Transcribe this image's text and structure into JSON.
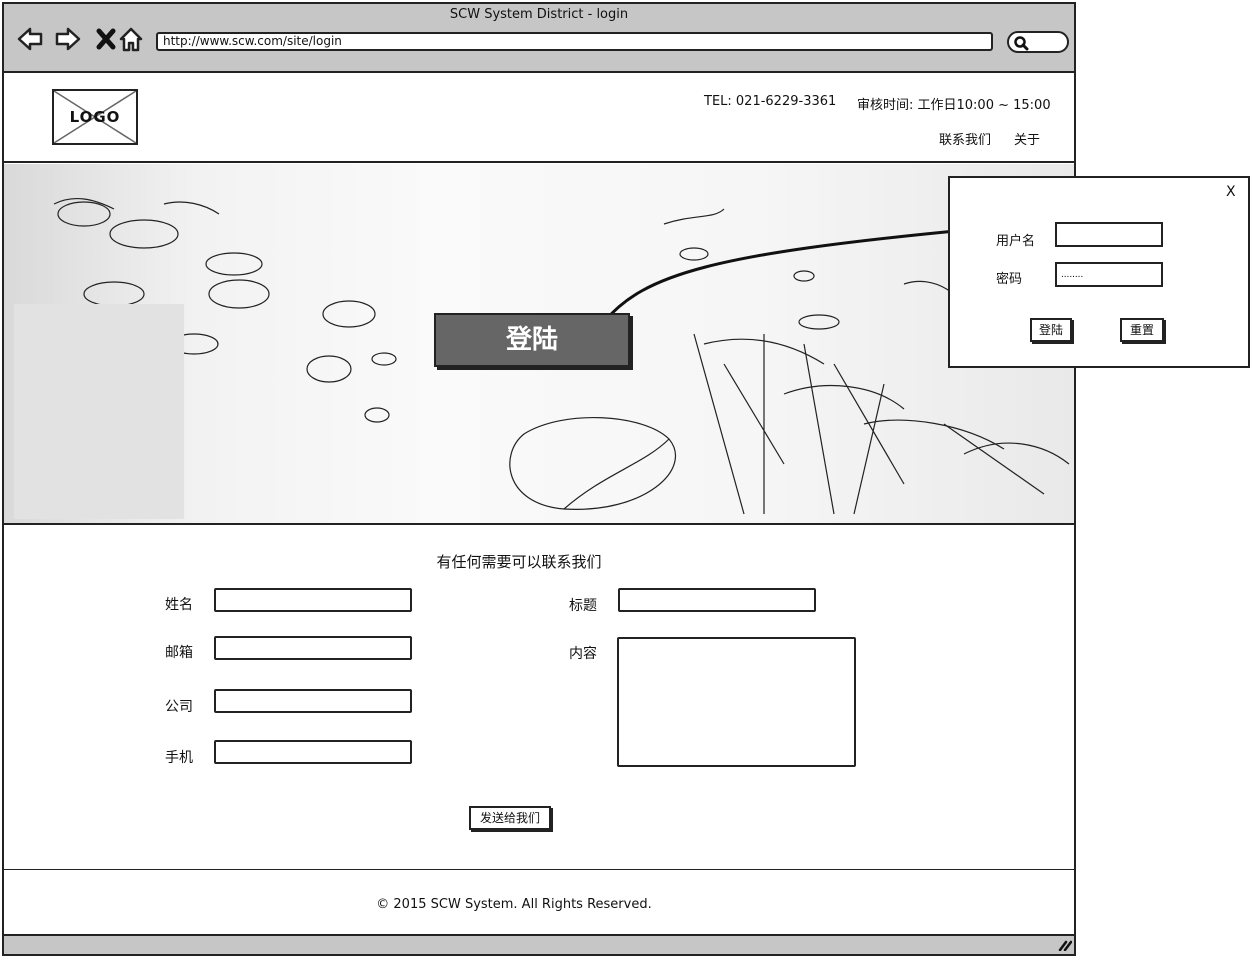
{
  "browser": {
    "title": "SCW System District - login",
    "url": "http://www.scw.com/site/login",
    "icons": [
      "back-arrow-icon",
      "forward-arrow-icon",
      "close-icon",
      "home-icon",
      "search-icon",
      "resize-grip-icon"
    ]
  },
  "header": {
    "logo": "LOGO",
    "tel": "TEL: 021-6229-3361",
    "hours": "审核时间: 工作日10:00 ~ 15:00",
    "links": [
      "联系我们",
      "关于"
    ]
  },
  "hero": {
    "login_button": "登陆"
  },
  "contact": {
    "title": "有任何需要可以联系我们",
    "fields": {
      "name": "姓名",
      "email": "邮箱",
      "company": "公司",
      "phone": "手机",
      "subject": "标题",
      "content": "内容"
    },
    "send_button": "发送给我们"
  },
  "footer": {
    "copyright": "© 2015 SCW System. All Rights Reserved."
  },
  "login_popup": {
    "close": "X",
    "username_label": "用户名",
    "password_label": "密码",
    "password_value": "........",
    "login_button": "登陆",
    "reset_button": "重置"
  }
}
